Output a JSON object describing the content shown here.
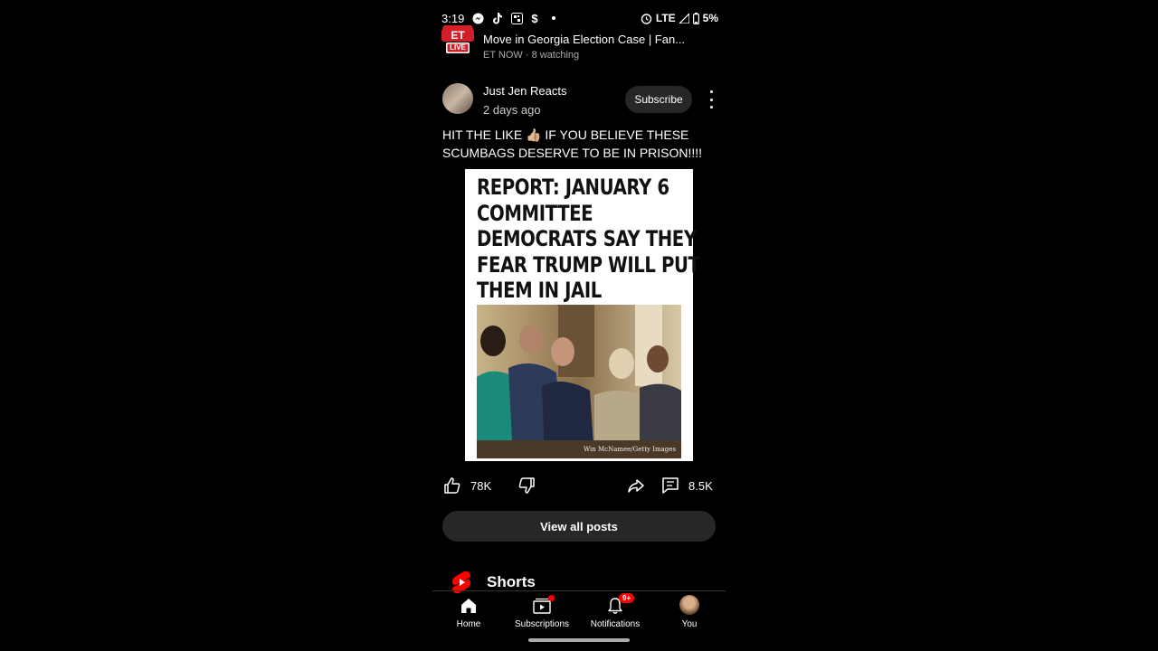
{
  "status_bar": {
    "time": "3:19",
    "network": "LTE",
    "battery": "5%"
  },
  "live_video": {
    "logo_text": "LIVE",
    "logo_brand": "ET",
    "title": "Move in Georgia Election Case | Fan...",
    "subtitle": "ET NOW · 8 watching"
  },
  "post": {
    "author": "Just Jen Reacts",
    "time": "2 days ago",
    "subscribe_label": "Subscribe",
    "text": "HIT THE LIKE 👍🏼 IF YOU BELIEVE THESE SCUMBAGS DESERVE TO BE IN PRISON!!!!",
    "image_headline": "REPORT: JANUARY 6\nCOMMITTEE\nDEMOCRATS SAY THEY\nFEAR TRUMP WILL PUT\nTHEM IN JAIL",
    "image_credit": "Win McNamee/Getty Images",
    "likes": "78K",
    "comments": "8.5K"
  },
  "view_all_label": "View all posts",
  "shorts_label": "Shorts",
  "nav": {
    "items": [
      {
        "label": "Home"
      },
      {
        "label": "Subscriptions"
      },
      {
        "label": "Notifications",
        "badge": "9+"
      },
      {
        "label": "You"
      }
    ]
  },
  "colors": {
    "background": "#000000",
    "chip": "#272727",
    "accent_red": "#ff0000"
  }
}
